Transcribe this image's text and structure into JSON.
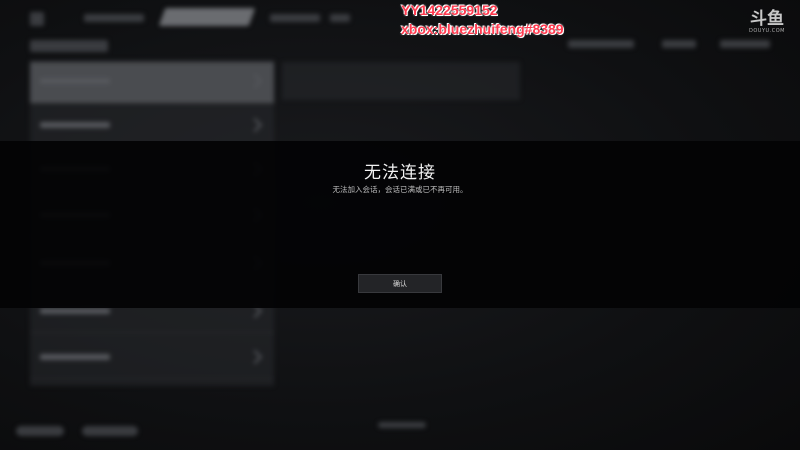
{
  "dialog": {
    "title": "无法连接",
    "message": "无法加入会话，会话已满或已不再可用。",
    "confirm_label": "确认"
  },
  "overlay": {
    "yy_id": "YY1422559152",
    "xbox_id": "xbox:bluezhuifeng#8389"
  },
  "watermark": {
    "logo_text": "斗鱼",
    "domain": "DOUYU.COM"
  },
  "colors": {
    "overlay_text": "#ff3a4f",
    "dialog_band": "#030304",
    "selected_row": "#4a4c50"
  }
}
